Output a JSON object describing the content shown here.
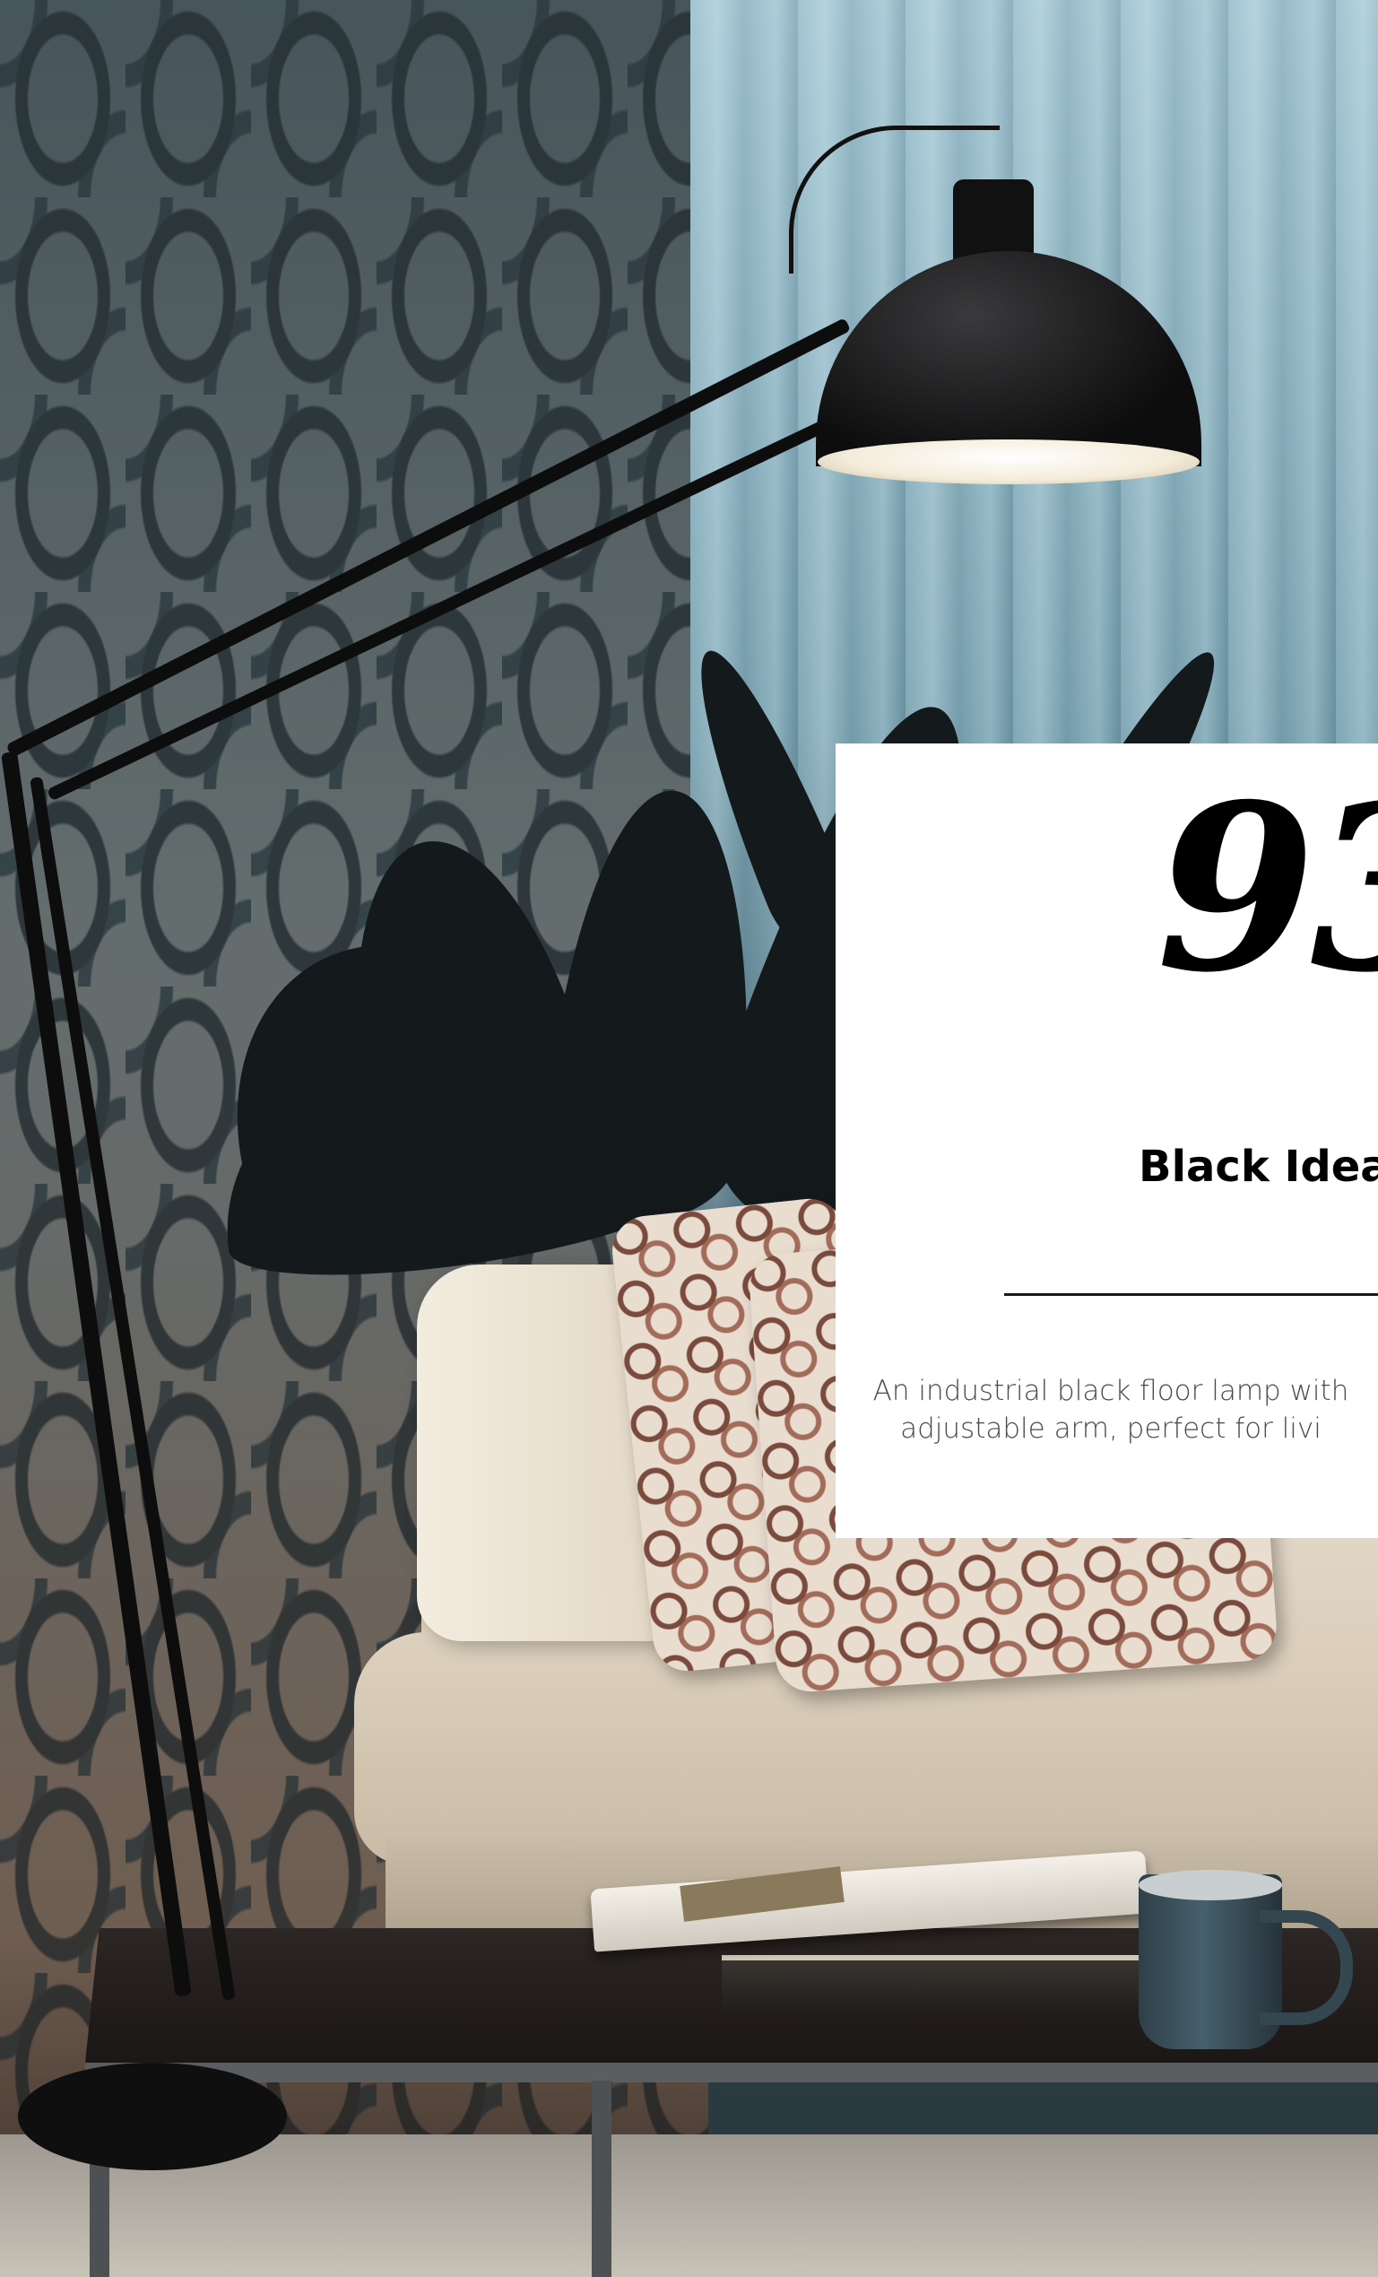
{
  "product": {
    "number": "93",
    "title": "Black Idea",
    "description_line1": "An industrial black floor lamp with",
    "description_line2": "adjustable arm, perfect for livi"
  },
  "colors": {
    "card_background": "#ffffff",
    "text_primary": "#000000",
    "text_secondary": "#4a4a4a"
  }
}
